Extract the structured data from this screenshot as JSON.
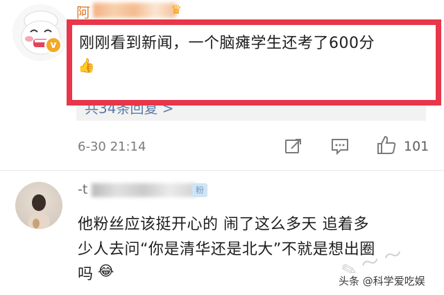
{
  "comment1": {
    "username_visible": "阿",
    "text": "刚刚看到新闻，一个脑瘫学生还考了600分",
    "emoji": "👍",
    "replies_link": "共34条回复 >",
    "time": "6-30 21:14",
    "likes": "101"
  },
  "comment2": {
    "username_visible": "-t",
    "fan_badge": "粉",
    "lines": [
      "他粉丝应该挺开心的 闹了这么多天 追着多",
      "少人去问“你是清华还是北大”不就是想出圈",
      "吗"
    ],
    "emoji": "😂"
  },
  "watermark": "头条 @科学爱吃娱",
  "colors": {
    "highlight": "#e8364a",
    "link": "#5b7aa8",
    "verified": "#f4a825"
  }
}
